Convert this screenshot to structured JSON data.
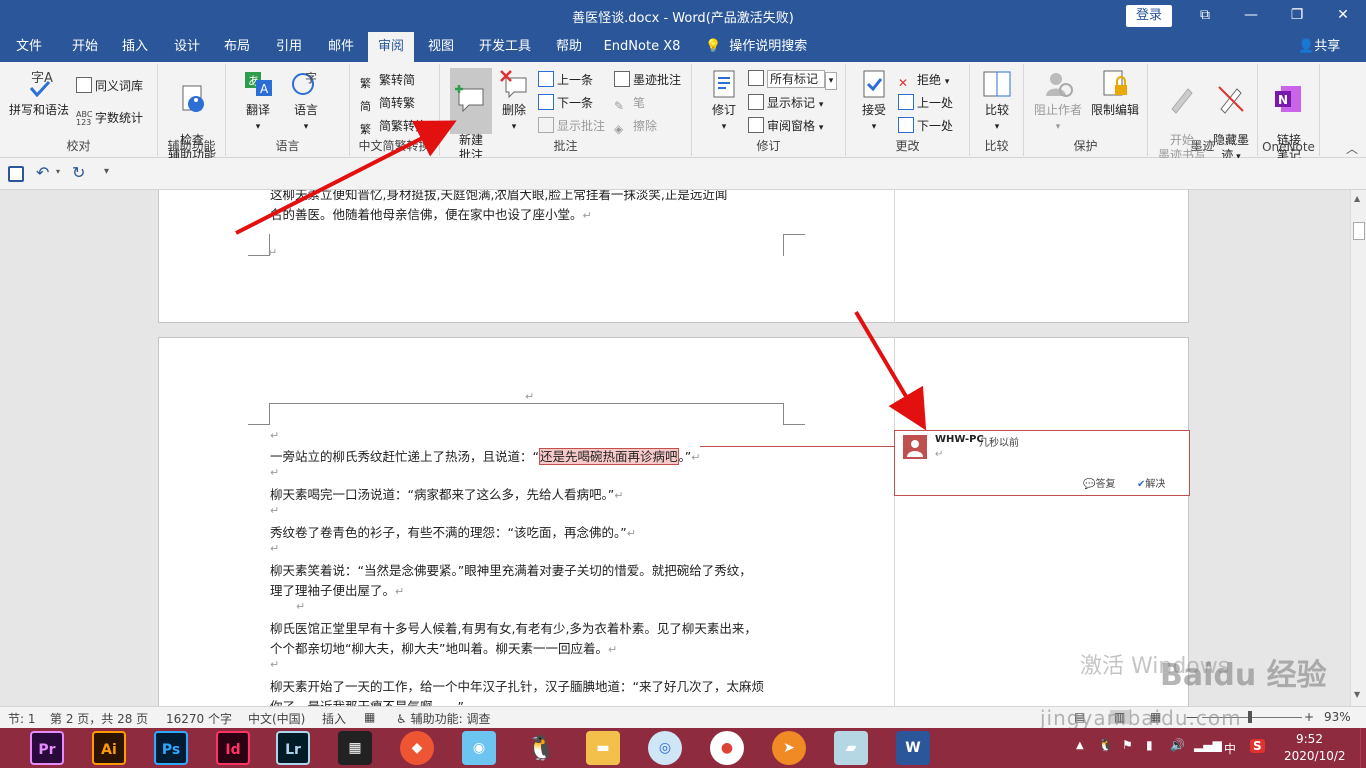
{
  "window": {
    "title": "善医怪谈.docx  -  Word(产品激活失败)",
    "login": "登录",
    "controls": [
      "⧉",
      "—",
      "❐",
      "✕"
    ]
  },
  "menu": {
    "tabs": [
      "文件",
      "开始",
      "插入",
      "设计",
      "布局",
      "引用",
      "邮件",
      "审阅",
      "视图",
      "开发工具",
      "帮助",
      "EndNote X8"
    ],
    "active": "审阅",
    "tell_me": "操作说明搜索",
    "share": "共享"
  },
  "ribbon": {
    "proofing": {
      "label": "校对",
      "spell": "拼写和语法",
      "thesaurus": "同义词库",
      "wordcount": "字数统计"
    },
    "accessibility": {
      "label": "辅助功能",
      "check": "检查\n辅助功能"
    },
    "language": {
      "label": "语言",
      "translate": "翻译",
      "language": "语言"
    },
    "chinese": {
      "label": "中文简繁转换",
      "t2s": "繁转简",
      "s2t": "简转繁",
      "convert": "简繁转换"
    },
    "comments": {
      "label": "批注",
      "new": "新建\n批注",
      "delete": "删除",
      "prev": "上一条",
      "next": "下一条",
      "show": "显示批注",
      "ink": "墨迹批注",
      "pen": "笔",
      "eraser": "擦除"
    },
    "tracking": {
      "label": "修订",
      "track": "修订",
      "markup_select": "所有标记",
      "show_markup": "显示标记",
      "review_pane": "审阅窗格"
    },
    "changes": {
      "label": "更改",
      "accept": "接受",
      "reject": "拒绝",
      "prev": "上一处",
      "next": "下一处"
    },
    "compare": {
      "label": "比较",
      "compare": "比较"
    },
    "protect": {
      "label": "保护",
      "block": "阻止作者",
      "restrict": "限制编辑"
    },
    "ink": {
      "label": "墨迹",
      "start": "开始\n墨迹书写",
      "hide": "隐藏墨\n迹"
    },
    "onenote": {
      "label": "OneNote",
      "linked": "链接\n笔记"
    }
  },
  "document": {
    "page1_lines": [
      "这柳天素立便知晋忆,身材挺拔,天庭饱满,浓眉大眼,脸上常挂着一抹淡笑,正是远近闻",
      "名的善医。他随着他母亲信佛，便在家中也设了座小堂。"
    ],
    "para1_pre": "一旁站立的柳氏秀纹赶忙递上了热汤，且说道：“",
    "para1_highlight": "还是先喝碗热面再诊病吧",
    "para1_post": "。”",
    "para2": "柳天素喝完一口汤说道：“病家都来了这么多，先给人看病吧。”",
    "para3": "秀纹卷了卷青色的衫子，有些不满的理怨：“该吃面，再念佛的。”",
    "para4_a": "柳天素笑着说：“当然是念佛要紧。”眼神里充满着对妻子关切的惜爱。就把碗给了秀纹，",
    "para4_b": "理了理袖子便出屋了。",
    "para5_a": "柳氏医馆正堂里早有十多号人候着,有男有女,有老有少,多为衣着朴素。见了柳天素出来，",
    "para5_b": "个个都亲切地“柳大夫，柳大夫”地叫着。柳天素一一回应着。",
    "para6_a": "柳天素开始了一天的工作，给一个中年汉子扎针，汉子腼腆地道：“来了好几次了，太麻烦",
    "para6_b": "你了，最近我那干瘪不是气啊……”",
    "para_mark": "↵"
  },
  "comment": {
    "author": "WHW-PC",
    "time": "几秒以前",
    "reply": "答复",
    "resolve": "解决"
  },
  "status": {
    "section": "节: 1",
    "page": "第 2 页，共 28 页",
    "words": "16270 个字",
    "language": "中文(中国)",
    "mode": "插入",
    "accessibility": "辅助功能: 调查",
    "zoom": "93%"
  },
  "taskbar": {
    "apps": [
      "Pr",
      "Ai",
      "Ps",
      "Id",
      "Lr"
    ],
    "time": "9:52",
    "date": "2020/10/2",
    "ime": "中"
  },
  "watermark": {
    "activate": "激活 Windows",
    "brand": "Baidu 经验",
    "url": "jingyan.baidu.com"
  }
}
